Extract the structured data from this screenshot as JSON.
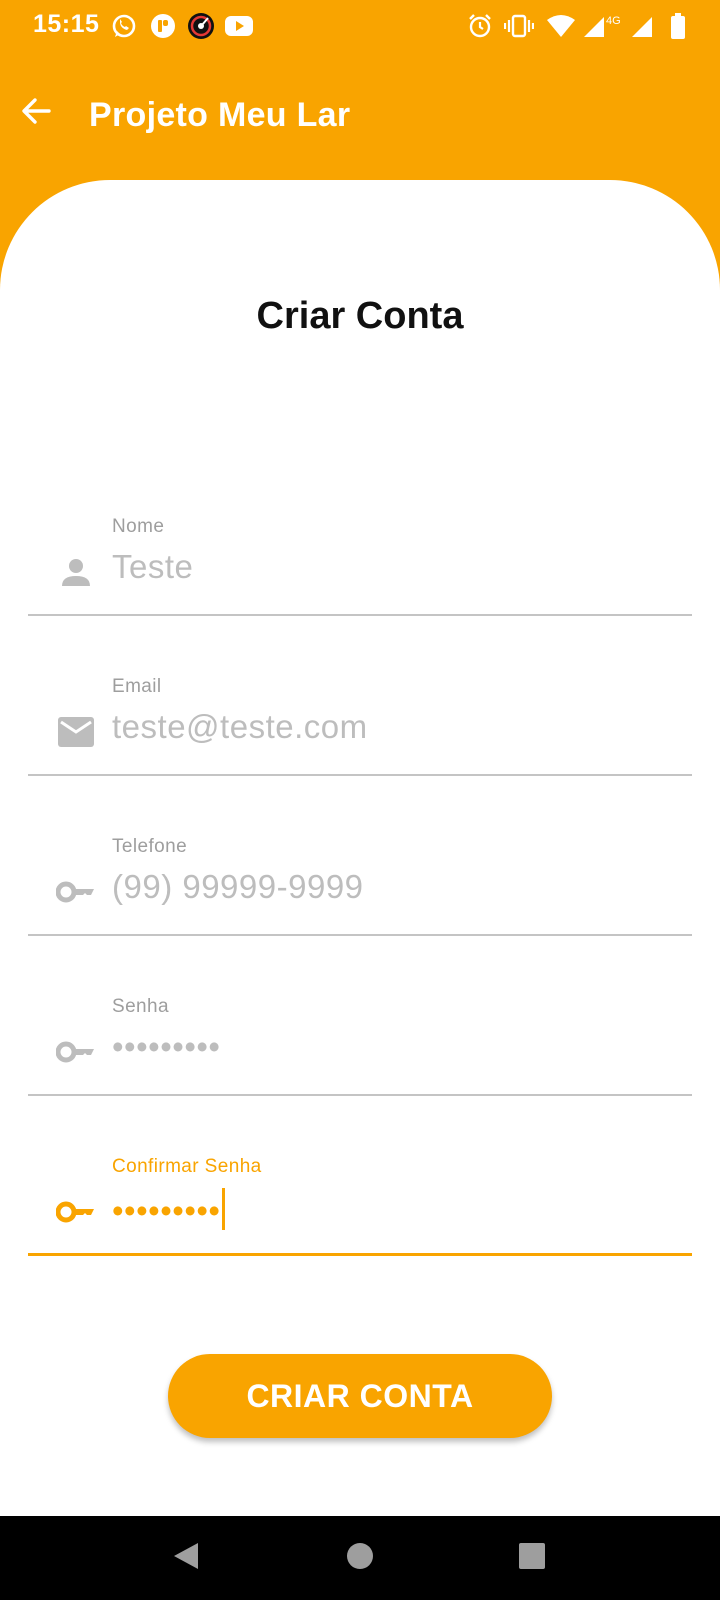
{
  "status_bar": {
    "time": "15:15",
    "network": "4G",
    "icons": [
      "whatsapp-icon",
      "app-notification-icon",
      "music-app-icon",
      "youtube-icon",
      "alarm-icon",
      "vibrate-icon",
      "wifi-icon",
      "signal-icon",
      "battery-icon"
    ]
  },
  "app_bar": {
    "title": "Projeto Meu Lar",
    "back_icon": "arrow-back-icon"
  },
  "form": {
    "title": "Criar Conta",
    "fields": [
      {
        "label": "Nome",
        "value": "Teste",
        "icon": "person-icon"
      },
      {
        "label": "Email",
        "value": "teste@teste.com",
        "icon": "email-icon"
      },
      {
        "label": "Telefone",
        "value": "(99) 99999-9999",
        "icon": "key-icon"
      },
      {
        "label": "Senha",
        "value": "•••••••••",
        "icon": "key-icon"
      },
      {
        "label": "Confirmar Senha",
        "value": "•••••••••",
        "icon": "key-icon",
        "focused": true
      }
    ],
    "submit_label": "CRIAR CONTA"
  },
  "colors": {
    "accent": "#F9A400",
    "surface": "#FFFFFF",
    "muted_text": "#BDBDBD",
    "nav_bar": "#000000"
  },
  "nav_bar": {
    "buttons": [
      "back-triangle-icon",
      "home-circle-icon",
      "recents-square-icon"
    ]
  }
}
